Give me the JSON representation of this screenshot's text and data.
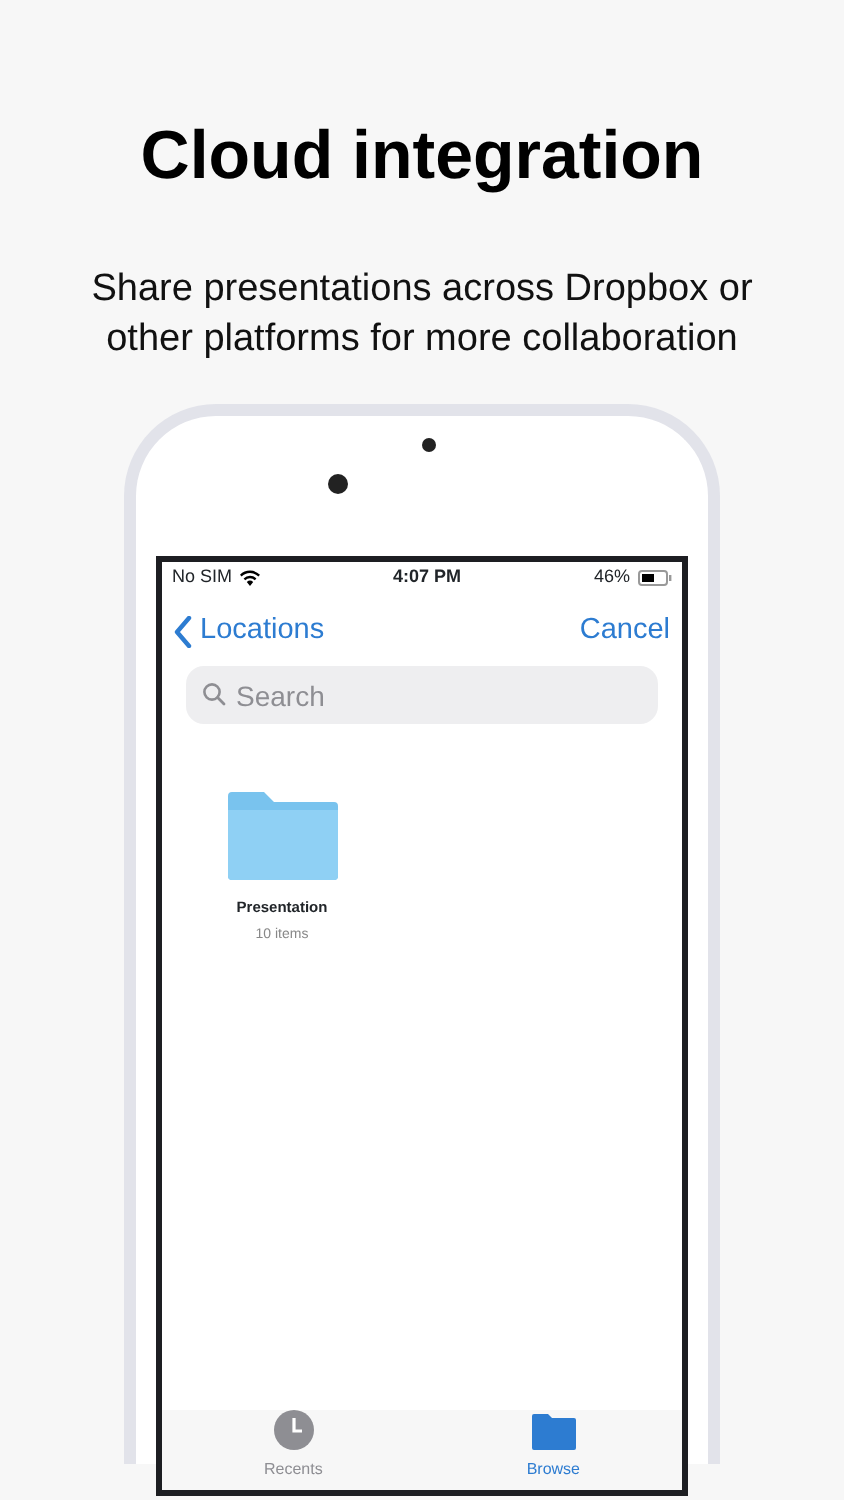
{
  "headline": "Cloud integration",
  "subtitle": "Share presentations across Dropbox or other platforms for more collaboration",
  "status_bar": {
    "carrier": "No SIM",
    "time": "4:07 PM",
    "battery": "46%"
  },
  "nav": {
    "back": "Locations",
    "action": "Cancel"
  },
  "search": {
    "placeholder": "Search"
  },
  "items": [
    {
      "name": "Presentation",
      "count": "10 items"
    }
  ],
  "tabs": [
    {
      "label": "Recents",
      "selected": false
    },
    {
      "label": "Browse",
      "selected": true
    }
  ]
}
